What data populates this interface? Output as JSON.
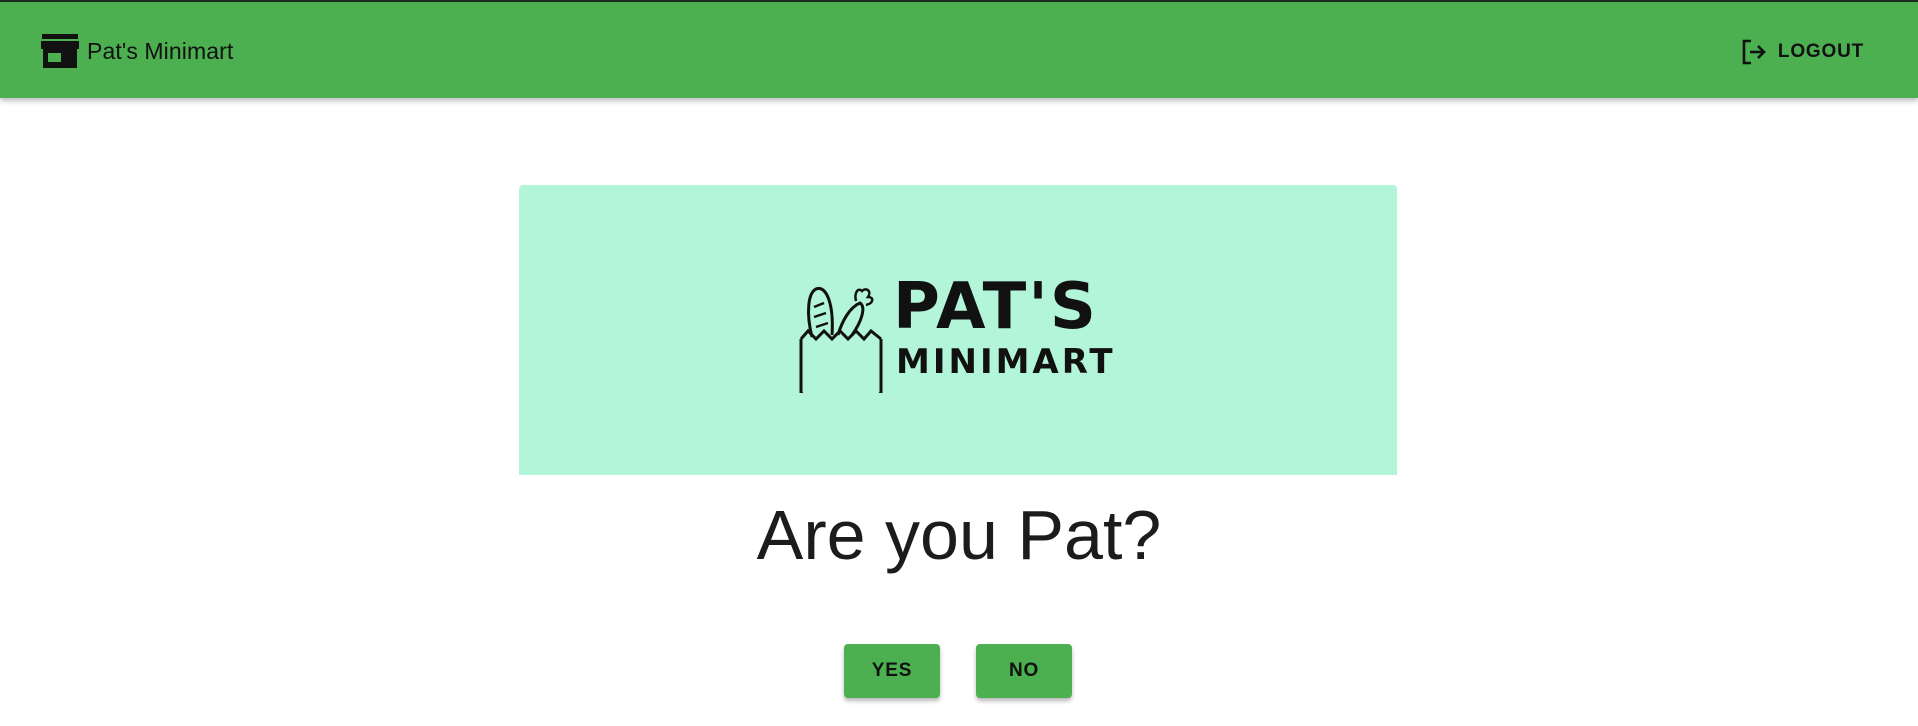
{
  "appbar": {
    "title": "Pat's Minimart",
    "brand_icon": "store-icon",
    "logout_label": "LOGOUT",
    "logout_icon": "logout-icon",
    "color": "#4caf50"
  },
  "hero": {
    "logo_line1": "PAT'S",
    "logo_line2": "MINIMART",
    "logo_icon": "grocery-bag-icon",
    "background": "#b2f5d9"
  },
  "prompt": {
    "question": "Are you Pat?",
    "yes_label": "YES",
    "no_label": "NO"
  }
}
